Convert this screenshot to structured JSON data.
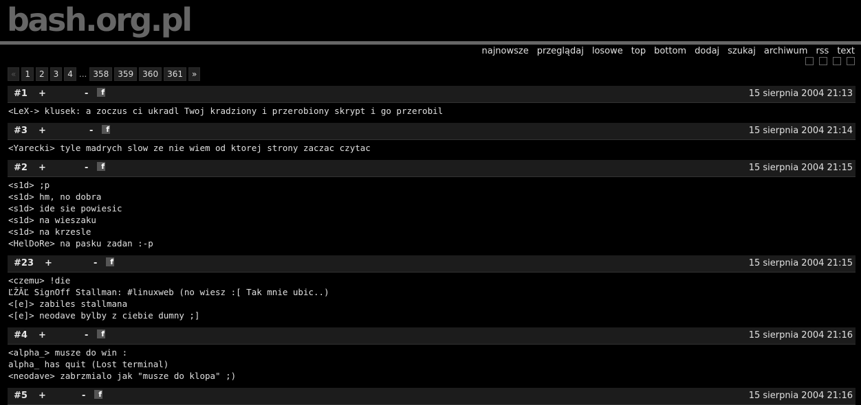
{
  "site": {
    "logo": "bash.org.pl"
  },
  "nav": [
    "najnowsze",
    "przeglądaj",
    "losowe",
    "top",
    "bottom",
    "dodaj",
    "szukaj",
    "archiwum",
    "rss",
    "text"
  ],
  "pager": {
    "prev": "«",
    "pages_start": [
      "1",
      "2",
      "3",
      "4"
    ],
    "ellipsis": "...",
    "pages_end": [
      "358",
      "359",
      "360",
      "361"
    ],
    "next": "»"
  },
  "quotes": [
    {
      "id": "#1",
      "plus": "+",
      "minus": "-",
      "date": "15 sierpnia 2004 21:13",
      "lines": [
        "<LeX-> klusek: a zoczus ci ukradl Twoj kradziony i przerobiony skrypt i go przerobil"
      ]
    },
    {
      "id": "#3",
      "plus": "+",
      "minus": "-",
      "date": "15 sierpnia 2004 21:14",
      "lines": [
        "<Yarecki> tyle madrych slow ze nie wiem od ktorej strony zaczac czytac"
      ]
    },
    {
      "id": "#2",
      "plus": "+",
      "minus": "-",
      "date": "15 sierpnia 2004 21:15",
      "lines": [
        "<s1d> ;p",
        "<s1d> hm, no dobra",
        "<s1d> ide sie powiesic",
        "<s1d> na wieszaku",
        "<s1d> na krzesle",
        "<HelDoRe> na pasku zadan :-p"
      ]
    },
    {
      "id": "#23",
      "plus": "+",
      "minus": "-",
      "date": "15 sierpnia 2004 21:15",
      "lines": [
        "<czemu> !die",
        "ĽŽĂĽ SignOff Stallman: #linuxweb (no wiesz :[ Tak mnie ubic..)",
        "<[e]> zabiles stallmana",
        "<[e]> neodave bylby z ciebie dumny ;]"
      ]
    },
    {
      "id": "#4",
      "plus": "+",
      "minus": "-",
      "date": "15 sierpnia 2004 21:16",
      "lines": [
        "<alpha_> musze do win :",
        "alpha_ has quit (Lost terminal)",
        "<neodave> zabrzmialo jak \"musze do klopa\" ;)"
      ]
    },
    {
      "id": "#5",
      "plus": "+",
      "minus": "-",
      "date": "15 sierpnia 2004 21:16",
      "lines": []
    }
  ]
}
